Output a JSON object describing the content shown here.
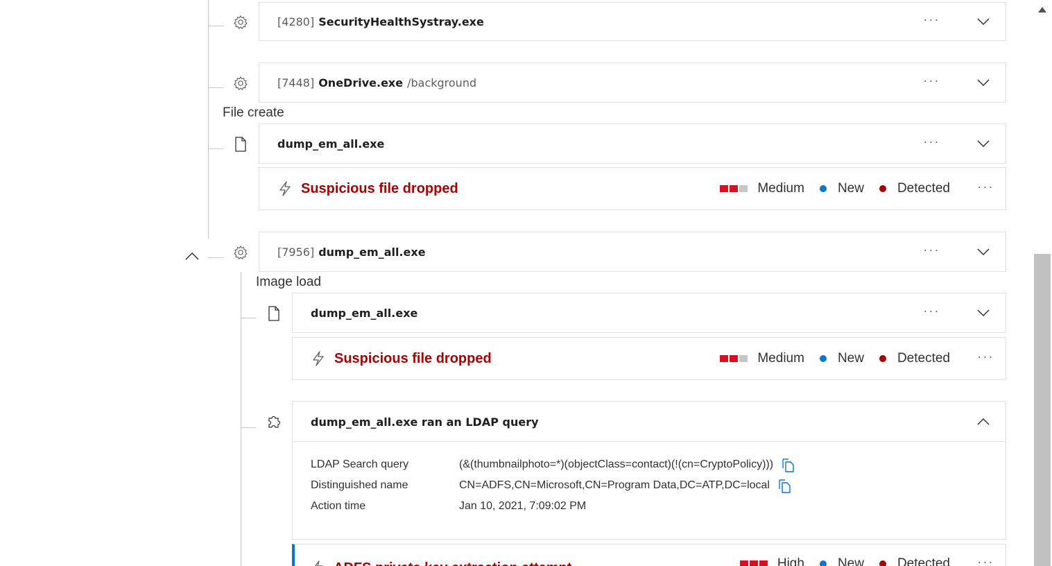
{
  "processes": {
    "p4280": {
      "pid": "[4280]",
      "name": "SecurityHealthSystray.exe",
      "args": ""
    },
    "p7448": {
      "pid": "[7448]",
      "name": "OneDrive.exe",
      "args": "/background"
    },
    "p7956": {
      "pid": "[7956]",
      "name": "dump_em_all.exe",
      "args": ""
    }
  },
  "labels": {
    "file_create": "File create",
    "image_load": "Image load"
  },
  "files": {
    "file1": "dump_em_all.exe",
    "file2": "dump_em_all.exe"
  },
  "alerts": {
    "a1": {
      "title": "Suspicious file dropped",
      "severity": "Medium",
      "status": "New",
      "detection": "Detected"
    },
    "a2": {
      "title": "Suspicious file dropped",
      "severity": "Medium",
      "status": "New",
      "detection": "Detected"
    },
    "a3": {
      "title": "ADFS private key extraction attempt",
      "severity": "High",
      "status": "New",
      "detection": "Detected"
    }
  },
  "ldap": {
    "title": "dump_em_all.exe ran an LDAP query",
    "rows": [
      {
        "key": "LDAP Search query",
        "value": "(&(thumbnailphoto=*)(objectClass=contact)(!(cn=CryptoPolicy)))"
      },
      {
        "key": "Distinguished name",
        "value": "CN=ADFS,CN=Microsoft,CN=Program Data,DC=ATP,DC=local"
      },
      {
        "key": "Action time",
        "value": "Jan 10, 2021, 7:09:02 PM"
      }
    ]
  },
  "ui": {
    "more": "···"
  },
  "colors": {
    "alert_red": "#a80000",
    "severity_red": "#e00b1c",
    "status_blue": "#0078d4",
    "detected_red": "#a80000",
    "accent": "#0078d4"
  },
  "icons": {
    "process": "gear-icon",
    "file": "document-icon",
    "alert": "lightning-icon",
    "ldap": "puzzle-icon",
    "copy": "copy-icon"
  }
}
